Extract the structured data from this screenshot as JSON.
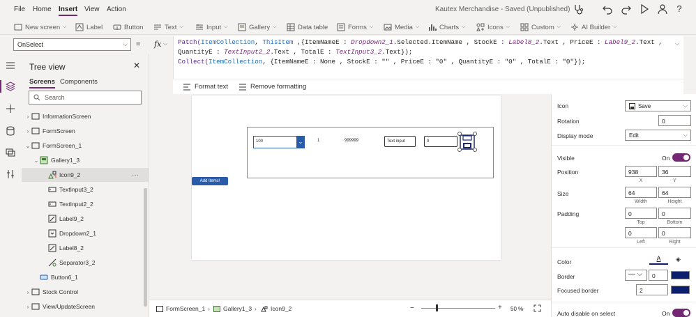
{
  "menubar": {
    "items": [
      "File",
      "Home",
      "Insert",
      "View",
      "Action"
    ],
    "active": "Insert",
    "title": "Kautex Merchandise - Saved (Unpublished)"
  },
  "ribbon": {
    "items": [
      {
        "label": "New screen",
        "icon": "new-screen-icon",
        "dropdown": true
      },
      {
        "label": "Label",
        "icon": "label-icon",
        "dropdown": false
      },
      {
        "label": "Button",
        "icon": "button-icon",
        "dropdown": false
      },
      {
        "label": "Text",
        "icon": "text-icon",
        "dropdown": true
      },
      {
        "label": "Input",
        "icon": "input-icon",
        "dropdown": true
      },
      {
        "label": "Gallery",
        "icon": "gallery-icon",
        "dropdown": true
      },
      {
        "label": "Data table",
        "icon": "data-table-icon",
        "dropdown": false
      },
      {
        "label": "Forms",
        "icon": "forms-icon",
        "dropdown": true
      },
      {
        "label": "Media",
        "icon": "media-icon",
        "dropdown": true
      },
      {
        "label": "Charts",
        "icon": "charts-icon",
        "dropdown": true
      },
      {
        "label": "Icons",
        "icon": "icons-icon",
        "dropdown": true
      },
      {
        "label": "Custom",
        "icon": "custom-icon",
        "dropdown": true
      },
      {
        "label": "AI Builder",
        "icon": "ai-builder-icon",
        "dropdown": true
      }
    ]
  },
  "formula": {
    "property": "OnSelect",
    "equals": "=",
    "fx": "fx",
    "line1_a": "Patch(",
    "line1_b": "ItemCollection",
    "line1_c": ", ",
    "line1_d": "ThisItem",
    "line1_e": " ,{ItemNameE : ",
    "line1_f": "Dropdown2_1",
    "line1_g": ".Selected.ItemName , StockE : ",
    "line1_h": "Label8_2",
    "line1_i": ".Text , PriceE : ",
    "line1_j": "Label9_2",
    "line1_k": ".Text ,",
    "line2_a": "QuantityE : ",
    "line2_b": "TextInput2_2",
    "line2_c": ".Text , TotalE : ",
    "line2_d": "TextInput3_2",
    "line2_e": ".Text});",
    "line3_a": "Collect(",
    "line3_b": "ItemCollection",
    "line3_c": ", {ItemNameE : None , StockE : \"\" , PriceE : \"0\" , QuantityE : \"0\" , TotalE : \"0\"});",
    "format_text": "Format text",
    "remove_formatting": "Remove formatting"
  },
  "tree": {
    "title": "Tree view",
    "tabs": [
      "Screens",
      "Components"
    ],
    "search_placeholder": "Search",
    "nodes": [
      {
        "label": "InformationScreen",
        "icon": "screen-icon",
        "twisty": ">"
      },
      {
        "label": "FormScreen",
        "icon": "screen-icon",
        "twisty": ">"
      },
      {
        "label": "FormScreen_1",
        "icon": "screen-icon",
        "twisty": "v"
      },
      {
        "label": "Gallery1_3",
        "icon": "gallery-icon",
        "twisty": "v"
      },
      {
        "label": "Icon9_2",
        "icon": "icon-control-icon",
        "twisty": ""
      },
      {
        "label": "TextInput3_2",
        "icon": "text-input-icon",
        "twisty": ""
      },
      {
        "label": "TextInput2_2",
        "icon": "text-input-icon",
        "twisty": ""
      },
      {
        "label": "Label9_2",
        "icon": "label-icon",
        "twisty": ""
      },
      {
        "label": "Dropdown2_1",
        "icon": "dropdown-icon",
        "twisty": ""
      },
      {
        "label": "Label8_2",
        "icon": "label-icon",
        "twisty": ""
      },
      {
        "label": "Separator3_2",
        "icon": "separator-icon",
        "twisty": ""
      },
      {
        "label": "Button6_1",
        "icon": "button-icon",
        "twisty": ""
      },
      {
        "label": "Stock Control",
        "icon": "screen-icon",
        "twisty": ">"
      },
      {
        "label": "View/UpdateScreen",
        "icon": "screen-icon",
        "twisty": ">"
      }
    ],
    "selected": "Icon9_2",
    "more": "···"
  },
  "canvas": {
    "dropdown_value": "100",
    "label_one": "1",
    "label_stock": "999999",
    "text_input": "Text input",
    "text_zero": "0",
    "add_button": "Add Items!"
  },
  "statusbar": {
    "crumbs": [
      "FormScreen_1",
      "Gallery1_3",
      "Icon9_2"
    ],
    "zoom": "50 %",
    "zoom_level": 0.2
  },
  "props": {
    "icon_label": "Icon",
    "icon_value": "Save",
    "rotation_label": "Rotation",
    "rotation_value": "0",
    "display_mode_label": "Display mode",
    "display_mode_value": "Edit",
    "visible_label": "Visible",
    "visible_value": "On",
    "position_label": "Position",
    "x": "938",
    "y": "36",
    "x_label": "X",
    "y_label": "Y",
    "size_label": "Size",
    "width": "64",
    "height": "64",
    "width_label": "Width",
    "height_label": "Height",
    "padding_label": "Padding",
    "pad_top": "0",
    "pad_bottom": "0",
    "pad_left": "0",
    "pad_right": "0",
    "top_label": "Top",
    "bottom_label": "Bottom",
    "left_label": "Left",
    "right_label": "Right",
    "color_label": "Color",
    "color_glyph": "A",
    "border_label": "Border",
    "border_value": "0",
    "focused_border_label": "Focused border",
    "focused_border_value": "2",
    "auto_disable_label": "Auto disable on select",
    "auto_disable_value": "On",
    "border_color": "#0b1d6f",
    "toggle_color": "#742774"
  }
}
